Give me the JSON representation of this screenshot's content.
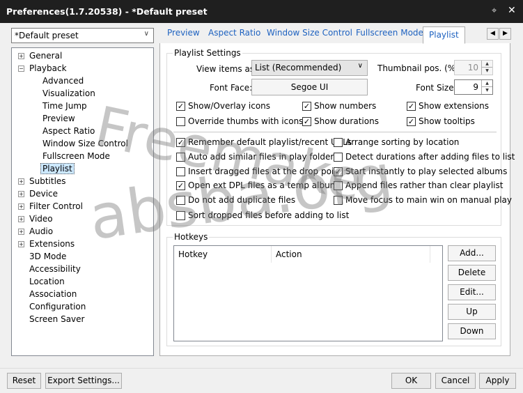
{
  "window": {
    "title": "Preferences(1.7.20538) - *Default preset",
    "pin_icon": "pin-icon",
    "close_icon": "close-icon"
  },
  "preset": {
    "value": "*Default preset"
  },
  "tree": [
    {
      "label": "General",
      "expander": "+"
    },
    {
      "label": "Playback",
      "expander": "-"
    },
    {
      "label": "Advanced"
    },
    {
      "label": "Visualization"
    },
    {
      "label": "Time Jump"
    },
    {
      "label": "Preview"
    },
    {
      "label": "Aspect Ratio"
    },
    {
      "label": "Window Size Control"
    },
    {
      "label": "Fullscreen Mode"
    },
    {
      "label": "Playlist",
      "selected": true
    },
    {
      "label": "Subtitles",
      "expander": "+"
    },
    {
      "label": "Device",
      "expander": "+"
    },
    {
      "label": "Filter Control",
      "expander": "+"
    },
    {
      "label": "Video",
      "expander": "+"
    },
    {
      "label": "Audio",
      "expander": "+"
    },
    {
      "label": "Extensions",
      "expander": "+"
    },
    {
      "label": "3D Mode"
    },
    {
      "label": "Accessibility"
    },
    {
      "label": "Location"
    },
    {
      "label": "Association"
    },
    {
      "label": "Configuration"
    },
    {
      "label": "Screen Saver"
    }
  ],
  "tabs": [
    "Preview",
    "Aspect Ratio",
    "Window Size Control",
    "Fullscreen Mode",
    "Playlist"
  ],
  "active_tab": "Playlist",
  "playlist_settings": {
    "group_label": "Playlist Settings",
    "view_items_label": "View items as:",
    "view_items_value": "List (Recommended)",
    "thumbnail_pos_label": "Thumbnail pos. (%):",
    "thumbnail_pos_value": "10",
    "font_face_label": "Font Face:",
    "font_face_value": "Segoe UI",
    "font_size_label": "Font Size:",
    "font_size_value": "9",
    "options": {
      "show_overlay_icons": {
        "label": "Show/Overlay icons",
        "checked": true
      },
      "show_numbers": {
        "label": "Show numbers",
        "checked": true
      },
      "show_extensions": {
        "label": "Show extensions",
        "checked": true
      },
      "override_thumbs": {
        "label": "Override thumbs with icons",
        "checked": false
      },
      "show_durations": {
        "label": "Show durations",
        "checked": true
      },
      "show_tooltips": {
        "label": "Show tooltips",
        "checked": true
      },
      "remember_playlist": {
        "label": "Remember default playlist/recent URLs",
        "checked": true
      },
      "arrange_sorting": {
        "label": "Arrange sorting by location",
        "checked": false
      },
      "auto_add_similar": {
        "label": "Auto add similar files in play folder",
        "checked": false
      },
      "detect_durations": {
        "label": "Detect durations after adding files to list",
        "checked": false
      },
      "insert_dragged": {
        "label": "Insert dragged files at the drop point",
        "checked": false
      },
      "start_instantly": {
        "label": "Start instantly to play selected albums",
        "checked": true
      },
      "open_ext_dpl": {
        "label": "Open ext DPL files as a temp album",
        "checked": true
      },
      "append_files": {
        "label": "Append files rather than clear playlist",
        "checked": false
      },
      "no_duplicates": {
        "label": "Do not add duplicate files",
        "checked": false
      },
      "move_focus": {
        "label": "Move focus to main win on manual play",
        "checked": false
      },
      "sort_dropped": {
        "label": "Sort dropped files before adding to list",
        "checked": false
      }
    }
  },
  "hotkeys": {
    "group_label": "Hotkeys",
    "columns": [
      "Hotkey",
      "Action"
    ],
    "rows": [],
    "buttons": {
      "add": "Add...",
      "delete": "Delete",
      "edit": "Edit...",
      "up": "Up",
      "down": "Down"
    }
  },
  "footer": {
    "reset": "Reset",
    "export": "Export Settings...",
    "ok": "OK",
    "cancel": "Cancel",
    "apply": "Apply"
  },
  "watermark": {
    "line1": "Freemake",
    "line2": "absba.org"
  }
}
